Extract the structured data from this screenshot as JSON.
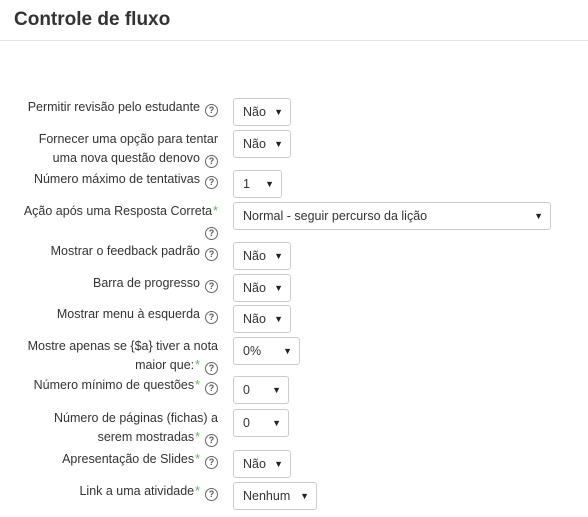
{
  "section": {
    "title": "Controle de fluxo"
  },
  "fields": [
    {
      "label_lines": [
        "Permitir revisão pelo estudante"
      ],
      "required": false,
      "value": "Não"
    },
    {
      "label_lines": [
        "Fornecer uma opção para tentar",
        "uma nova questão denovo"
      ],
      "required": false,
      "value": "Não"
    },
    {
      "label_lines": [
        "Número máximo de tentativas"
      ],
      "required": false,
      "value": "1"
    },
    {
      "label_lines": [
        "Ação após uma Resposta Correta"
      ],
      "required": true,
      "value": "Normal - seguir percurso da lição"
    },
    {
      "label_lines": [
        "Mostrar o feedback padrão"
      ],
      "required": false,
      "value": "Não"
    },
    {
      "label_lines": [
        "Barra de progresso"
      ],
      "required": false,
      "value": "Não"
    },
    {
      "label_lines": [
        "Mostrar menu à esquerda"
      ],
      "required": false,
      "value": "Não"
    },
    {
      "label_lines": [
        "Mostre apenas se {$a} tiver a nota",
        "maior que:"
      ],
      "required": true,
      "value": "0%"
    },
    {
      "label_lines": [
        "Número mínimo de questões"
      ],
      "required": true,
      "value": "0"
    },
    {
      "label_lines": [
        "Número de páginas (fichas) a",
        "serem mostradas"
      ],
      "required": true,
      "value": "0"
    },
    {
      "label_lines": [
        "Apresentação de Slides"
      ],
      "required": true,
      "value": "Não"
    },
    {
      "label_lines": [
        "Link a uma atividade"
      ],
      "required": true,
      "value": "Nenhum"
    }
  ],
  "icons": {
    "help": "question-circle-icon",
    "dropdown": "caret-down-icon"
  },
  "glyphs": {
    "help": "?",
    "caret": "▼",
    "required_marker": "*"
  },
  "colors": {
    "required_marker": "#5bb75b",
    "select_border": "#cccccc",
    "text": "#333333"
  }
}
